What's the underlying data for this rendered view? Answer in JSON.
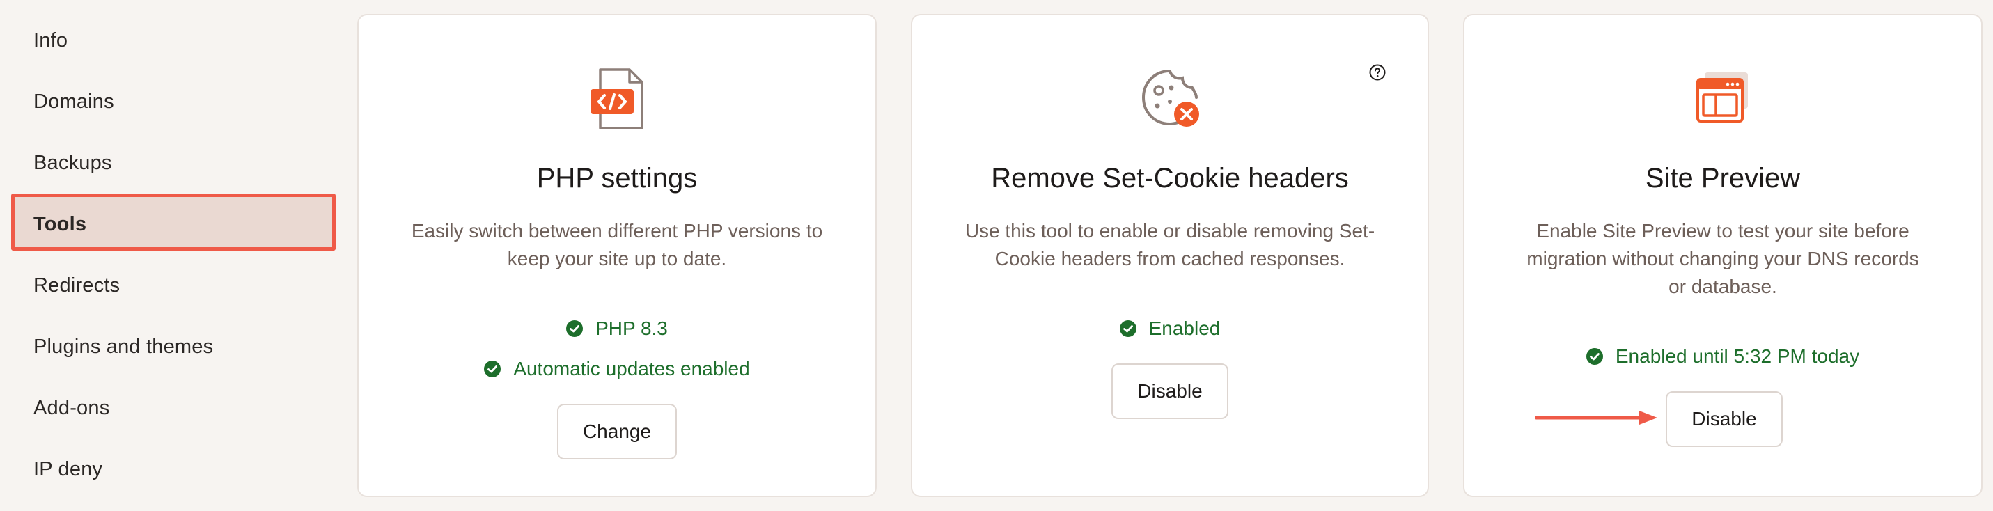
{
  "sidebar": {
    "items": [
      {
        "label": "Info"
      },
      {
        "label": "Domains"
      },
      {
        "label": "Backups"
      },
      {
        "label": "Tools",
        "active": true
      },
      {
        "label": "Redirects"
      },
      {
        "label": "Plugins and themes"
      },
      {
        "label": "Add-ons"
      },
      {
        "label": "IP deny"
      }
    ]
  },
  "cards": [
    {
      "icon": "php-code-file-icon",
      "title": "PHP settings",
      "description": "Easily switch between different PHP versions to keep your site up to date.",
      "status": [
        "PHP 8.3",
        "Automatic updates enabled"
      ],
      "button": "Change"
    },
    {
      "icon": "cookie-remove-icon",
      "title": "Remove Set-Cookie headers",
      "description": "Use this tool to enable or disable removing Set-Cookie headers from cached responses.",
      "status": [
        "Enabled"
      ],
      "button": "Disable"
    },
    {
      "icon": "site-preview-browser-icon",
      "title": "Site Preview",
      "description": "Enable Site Preview to test your site before migration without changing your DNS records or database.",
      "status": [
        "Enabled until 5:32 PM today"
      ],
      "button": "Disable"
    }
  ],
  "colors": {
    "accent": "#f05a28",
    "highlight_border": "#ef5a48",
    "highlight_fill": "#ead9d2",
    "status_green": "#1d6e2b",
    "background": "#f7f4f1"
  }
}
